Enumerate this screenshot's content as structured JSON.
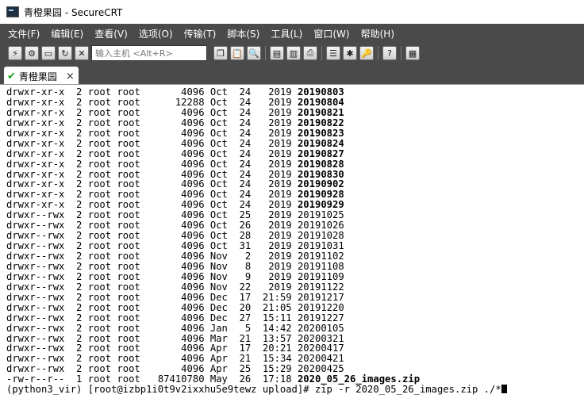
{
  "window": {
    "title": "青橙果园 - SecureCRT"
  },
  "menu": [
    "文件(F)",
    "编辑(E)",
    "查看(V)",
    "选项(O)",
    "传输(T)",
    "脚本(S)",
    "工具(L)",
    "窗口(W)",
    "帮助(H)"
  ],
  "toolbar": {
    "host_input_placeholder": "输入主机 <Alt+R>"
  },
  "tab": {
    "label": "青橙果园",
    "close": "×"
  },
  "terminal": {
    "lines": [
      {
        "perm": "drwxr-xr-x",
        "links": "2",
        "owner": "root",
        "group": "root",
        "size": "4096",
        "month": "Oct",
        "day": "24",
        "time": "2019",
        "name": "20190803",
        "bold": true
      },
      {
        "perm": "drwxr-xr-x",
        "links": "2",
        "owner": "root",
        "group": "root",
        "size": "12288",
        "month": "Oct",
        "day": "24",
        "time": "2019",
        "name": "20190804",
        "bold": true
      },
      {
        "perm": "drwxr-xr-x",
        "links": "2",
        "owner": "root",
        "group": "root",
        "size": "4096",
        "month": "Oct",
        "day": "24",
        "time": "2019",
        "name": "20190821",
        "bold": true
      },
      {
        "perm": "drwxr-xr-x",
        "links": "2",
        "owner": "root",
        "group": "root",
        "size": "4096",
        "month": "Oct",
        "day": "24",
        "time": "2019",
        "name": "20190822",
        "bold": true
      },
      {
        "perm": "drwxr-xr-x",
        "links": "2",
        "owner": "root",
        "group": "root",
        "size": "4096",
        "month": "Oct",
        "day": "24",
        "time": "2019",
        "name": "20190823",
        "bold": true
      },
      {
        "perm": "drwxr-xr-x",
        "links": "2",
        "owner": "root",
        "group": "root",
        "size": "4096",
        "month": "Oct",
        "day": "24",
        "time": "2019",
        "name": "20190824",
        "bold": true
      },
      {
        "perm": "drwxr-xr-x",
        "links": "2",
        "owner": "root",
        "group": "root",
        "size": "4096",
        "month": "Oct",
        "day": "24",
        "time": "2019",
        "name": "20190827",
        "bold": true
      },
      {
        "perm": "drwxr-xr-x",
        "links": "2",
        "owner": "root",
        "group": "root",
        "size": "4096",
        "month": "Oct",
        "day": "24",
        "time": "2019",
        "name": "20190828",
        "bold": true
      },
      {
        "perm": "drwxr-xr-x",
        "links": "2",
        "owner": "root",
        "group": "root",
        "size": "4096",
        "month": "Oct",
        "day": "24",
        "time": "2019",
        "name": "20190830",
        "bold": true
      },
      {
        "perm": "drwxr-xr-x",
        "links": "2",
        "owner": "root",
        "group": "root",
        "size": "4096",
        "month": "Oct",
        "day": "24",
        "time": "2019",
        "name": "20190902",
        "bold": true
      },
      {
        "perm": "drwxr-xr-x",
        "links": "2",
        "owner": "root",
        "group": "root",
        "size": "4096",
        "month": "Oct",
        "day": "24",
        "time": "2019",
        "name": "20190928",
        "bold": true
      },
      {
        "perm": "drwxr-xr-x",
        "links": "2",
        "owner": "root",
        "group": "root",
        "size": "4096",
        "month": "Oct",
        "day": "24",
        "time": "2019",
        "name": "20190929",
        "bold": true
      },
      {
        "perm": "drwxr--rwx",
        "links": "2",
        "owner": "root",
        "group": "root",
        "size": "4096",
        "month": "Oct",
        "day": "25",
        "time": "2019",
        "name": "20191025",
        "bold": false
      },
      {
        "perm": "drwxr--rwx",
        "links": "2",
        "owner": "root",
        "group": "root",
        "size": "4096",
        "month": "Oct",
        "day": "26",
        "time": "2019",
        "name": "20191026",
        "bold": false
      },
      {
        "perm": "drwxr--rwx",
        "links": "2",
        "owner": "root",
        "group": "root",
        "size": "4096",
        "month": "Oct",
        "day": "28",
        "time": "2019",
        "name": "20191028",
        "bold": false
      },
      {
        "perm": "drwxr--rwx",
        "links": "2",
        "owner": "root",
        "group": "root",
        "size": "4096",
        "month": "Oct",
        "day": "31",
        "time": "2019",
        "name": "20191031",
        "bold": false
      },
      {
        "perm": "drwxr--rwx",
        "links": "2",
        "owner": "root",
        "group": "root",
        "size": "4096",
        "month": "Nov",
        "day": "2",
        "time": "2019",
        "name": "20191102",
        "bold": false
      },
      {
        "perm": "drwxr--rwx",
        "links": "2",
        "owner": "root",
        "group": "root",
        "size": "4096",
        "month": "Nov",
        "day": "8",
        "time": "2019",
        "name": "20191108",
        "bold": false
      },
      {
        "perm": "drwxr--rwx",
        "links": "2",
        "owner": "root",
        "group": "root",
        "size": "4096",
        "month": "Nov",
        "day": "9",
        "time": "2019",
        "name": "20191109",
        "bold": false
      },
      {
        "perm": "drwxr--rwx",
        "links": "2",
        "owner": "root",
        "group": "root",
        "size": "4096",
        "month": "Nov",
        "day": "22",
        "time": "2019",
        "name": "20191122",
        "bold": false
      },
      {
        "perm": "drwxr--rwx",
        "links": "2",
        "owner": "root",
        "group": "root",
        "size": "4096",
        "month": "Dec",
        "day": "17",
        "time": "21:59",
        "name": "20191217",
        "bold": false
      },
      {
        "perm": "drwxr--rwx",
        "links": "2",
        "owner": "root",
        "group": "root",
        "size": "4096",
        "month": "Dec",
        "day": "20",
        "time": "21:05",
        "name": "20191220",
        "bold": false
      },
      {
        "perm": "drwxr--rwx",
        "links": "2",
        "owner": "root",
        "group": "root",
        "size": "4096",
        "month": "Dec",
        "day": "27",
        "time": "15:11",
        "name": "20191227",
        "bold": false
      },
      {
        "perm": "drwxr--rwx",
        "links": "2",
        "owner": "root",
        "group": "root",
        "size": "4096",
        "month": "Jan",
        "day": "5",
        "time": "14:42",
        "name": "20200105",
        "bold": false
      },
      {
        "perm": "drwxr--rwx",
        "links": "2",
        "owner": "root",
        "group": "root",
        "size": "4096",
        "month": "Mar",
        "day": "21",
        "time": "13:57",
        "name": "20200321",
        "bold": false
      },
      {
        "perm": "drwxr--rwx",
        "links": "2",
        "owner": "root",
        "group": "root",
        "size": "4096",
        "month": "Apr",
        "day": "17",
        "time": "20:21",
        "name": "20200417",
        "bold": false
      },
      {
        "perm": "drwxr--rwx",
        "links": "2",
        "owner": "root",
        "group": "root",
        "size": "4096",
        "month": "Apr",
        "day": "21",
        "time": "15:34",
        "name": "20200421",
        "bold": false
      },
      {
        "perm": "drwxr--rwx",
        "links": "2",
        "owner": "root",
        "group": "root",
        "size": "4096",
        "month": "Apr",
        "day": "25",
        "time": "15:29",
        "name": "20200425",
        "bold": false
      },
      {
        "perm": "-rw-r--r--",
        "links": "1",
        "owner": "root",
        "group": "root",
        "size": "87410780",
        "month": "May",
        "day": "26",
        "time": "17:18",
        "name": "2020_05_26_images.zip",
        "bold": true
      }
    ],
    "prompt": "(python3_vir) [root@izbp1i0t9v2ixxhu5e9tewz upload]# zip -r 2020_05_26_images.zip ./*"
  }
}
